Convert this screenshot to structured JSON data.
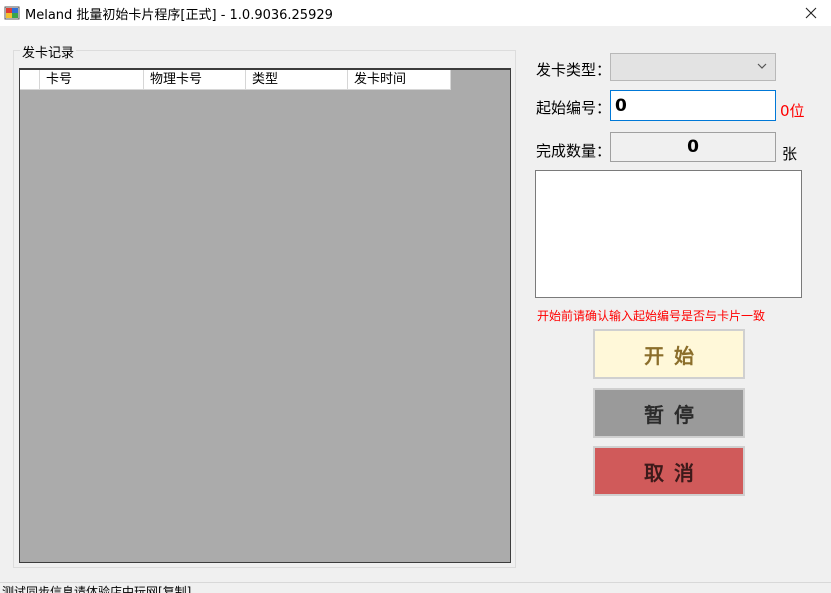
{
  "window": {
    "title": "Meland 批量初始卡片程序[正式] - 1.0.9036.25929",
    "close_glyph": "✕"
  },
  "group": {
    "legend": "发卡记录"
  },
  "grid": {
    "columns": [
      "卡号",
      "物理卡号",
      "类型",
      "发卡时间"
    ],
    "rows": []
  },
  "form": {
    "card_type_label": "发卡类型：",
    "card_type_value": "",
    "start_no_label": "起始编号：",
    "start_no_value": "0",
    "digits_suffix": "0位",
    "done_count_label": "完成数量：",
    "done_count_value": "0",
    "count_unit": "张",
    "log_text": "",
    "warning": "开始前请确认输入起始编号是否与卡片一致"
  },
  "buttons": {
    "start": "开始",
    "pause": "暂停",
    "cancel": "取消"
  },
  "status": {
    "text": "测试同步信息请体验店中玩网[复制]"
  },
  "colors": {
    "start_bg": "#fff8d9",
    "pause_bg": "#9a9a9a",
    "cancel_bg": "#d05a5a",
    "warning": "#ff0000",
    "grid_bg": "#ababab"
  }
}
